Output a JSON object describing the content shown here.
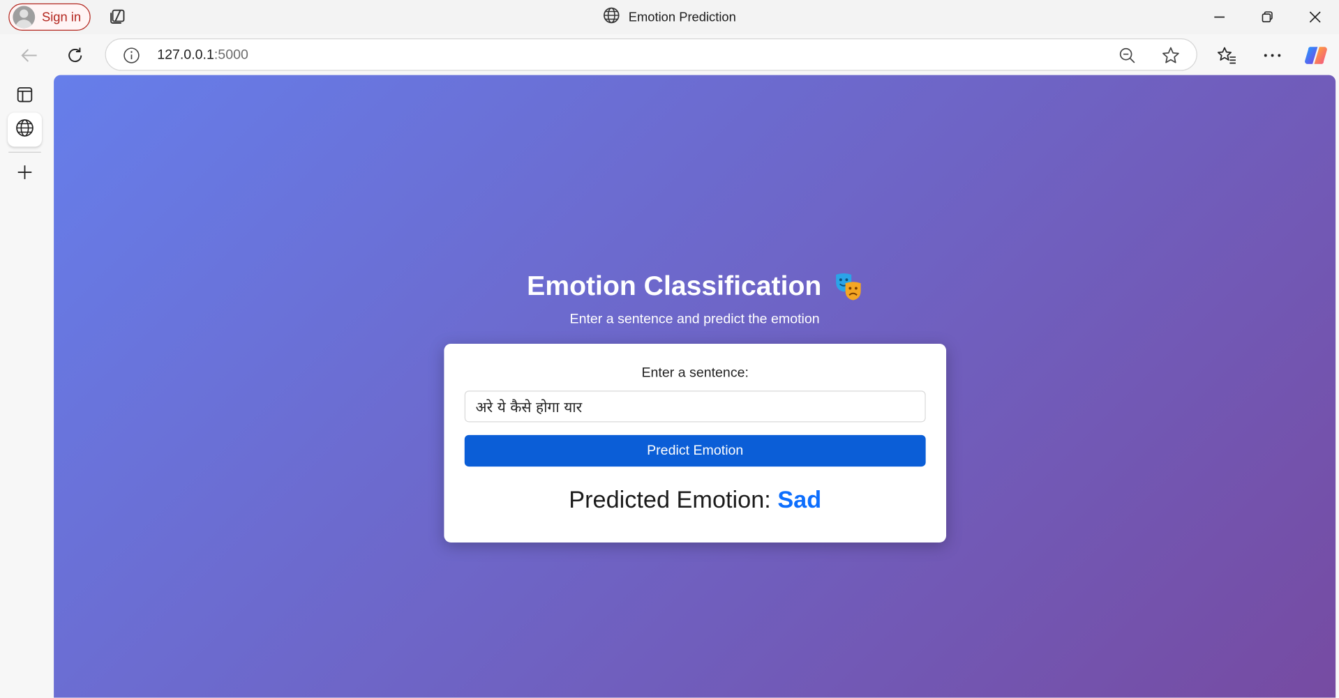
{
  "browser": {
    "signin_label": "Sign in",
    "window_title": "Emotion Prediction",
    "url_host": "127.0.0.1",
    "url_port": ":5000"
  },
  "icons": {
    "tab_actions": "tab-actions-icon",
    "site": "globe-icon",
    "back": "back-arrow-icon",
    "refresh": "refresh-icon",
    "info": "info-icon",
    "zoom_out": "zoom-out-icon",
    "favorite": "star-icon",
    "favorites_list": "favorites-icon",
    "more": "more-icon",
    "copilot": "copilot-icon",
    "minimize": "minimize-icon",
    "restore": "restore-icon",
    "close": "close-icon",
    "sidebar_tabs": "vertical-tabs-icon",
    "sidebar_globe": "globe-icon",
    "sidebar_add": "plus-icon"
  },
  "page": {
    "heading": "Emotion Classification",
    "heading_emoji": "🎭",
    "subheading": "Enter a sentence and predict the emotion",
    "form": {
      "label": "Enter a sentence:",
      "input_value": "अरे ये कैसे होगा यार",
      "button_label": "Predict Emotion"
    },
    "result": {
      "prefix": "Predicted Emotion:",
      "emotion": "Sad"
    }
  },
  "colors": {
    "gradient_start": "#667eea",
    "gradient_end": "#764ba2",
    "button": "#0b5ed7",
    "emotion_text": "#0d6efd",
    "signin_accent": "#b3261e"
  }
}
